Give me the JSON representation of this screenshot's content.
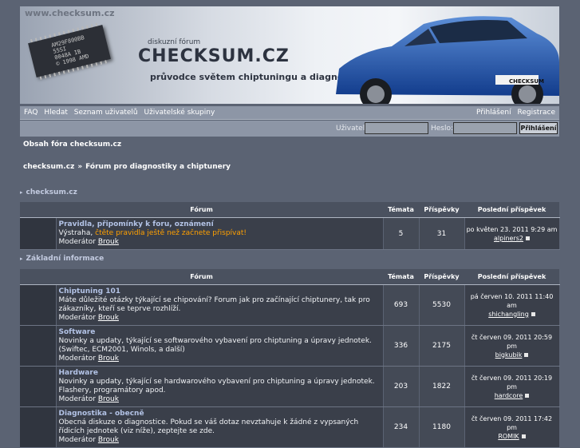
{
  "banner": {
    "url": "www.checksum.cz",
    "chip_text": "AM29F800BB\n55SI\n0048A IB\n© 1998 AMD",
    "subtitle": "diskuzní fórum",
    "title": "CHECKSUM.CZ",
    "tagline": "průvodce světem chiptuningu a diagnostiky",
    "plate": "CHECKSUM"
  },
  "nav": {
    "left": [
      "FAQ",
      "Hledat",
      "Seznam uživatelů",
      "Uživatelské skupiny"
    ],
    "right": [
      "Přihlášení",
      "Registrace"
    ]
  },
  "login": {
    "user_label": "Uživatel:",
    "pass_label": "Heslo:",
    "button": "Přihlášení"
  },
  "heading": "Obsah fóra checksum.cz",
  "breadcrumb": [
    "checksum.cz",
    "»",
    "Fórum pro diagnostiky a chiptunery"
  ],
  "columns": [
    "Fórum",
    "Témata",
    "Příspěvky",
    "Poslední příspěvek"
  ],
  "categories": [
    {
      "name": "checksum.cz",
      "forums": [
        {
          "title": "Pravidla, připomínky k foru, oznámení",
          "desc_prefix": "Výstraha, ",
          "desc_warn": "čtěte pravidla ještě než začnete přispívat!",
          "moderator_label": "Moderátor",
          "moderator": "Brouk",
          "topics": "5",
          "posts": "31",
          "last_date": "po květen 23. 2011 9:29 am",
          "last_user": "alpiners2"
        }
      ]
    },
    {
      "name": "Základní informace",
      "forums": [
        {
          "title": "Chiptuning 101",
          "desc": "Máte důležité otázky týkající se chipování? Forum jak pro začínající chiptunery, tak pro zákazníky, kteří se teprve rozhlíží.",
          "moderator_label": "Moderátor",
          "moderator": "Brouk",
          "topics": "693",
          "posts": "5530",
          "last_date": "pá červen 10. 2011 11:40 am",
          "last_user": "shichangling"
        },
        {
          "title": "Software",
          "desc": "Novinky a updaty, týkající se softwarového vybavení pro chiptuning a úpravy jednotek. (Swiftec, ECM2001, Winols, a další)",
          "moderator_label": "Moderátor",
          "moderator": "Brouk",
          "topics": "336",
          "posts": "2175",
          "last_date": "čt červen 09. 2011 20:59 pm",
          "last_user": "bigkubik"
        },
        {
          "title": "Hardware",
          "desc": "Novinky a updaty, týkající se hardwarového vybavení pro chiptuning a úpravy jednotek. Flashery, programátory apod.",
          "moderator_label": "Moderátor",
          "moderator": "Brouk",
          "topics": "203",
          "posts": "1822",
          "last_date": "čt červen 09. 2011 20:19 pm",
          "last_user": "hardcore"
        },
        {
          "title": "Diagnostika - obecně",
          "desc": "Obecná diskuze o diagnostice. Pokud se váš dotaz nevztahuje k žádné z vypsaných řídicích jednotek (viz níže), zeptejte se zde.",
          "moderator_label": "Moderátor",
          "moderator": "Brouk",
          "topics": "234",
          "posts": "1180",
          "last_date": "čt červen 09. 2011 17:42 pm",
          "last_user": "ROMIK"
        }
      ]
    }
  ]
}
